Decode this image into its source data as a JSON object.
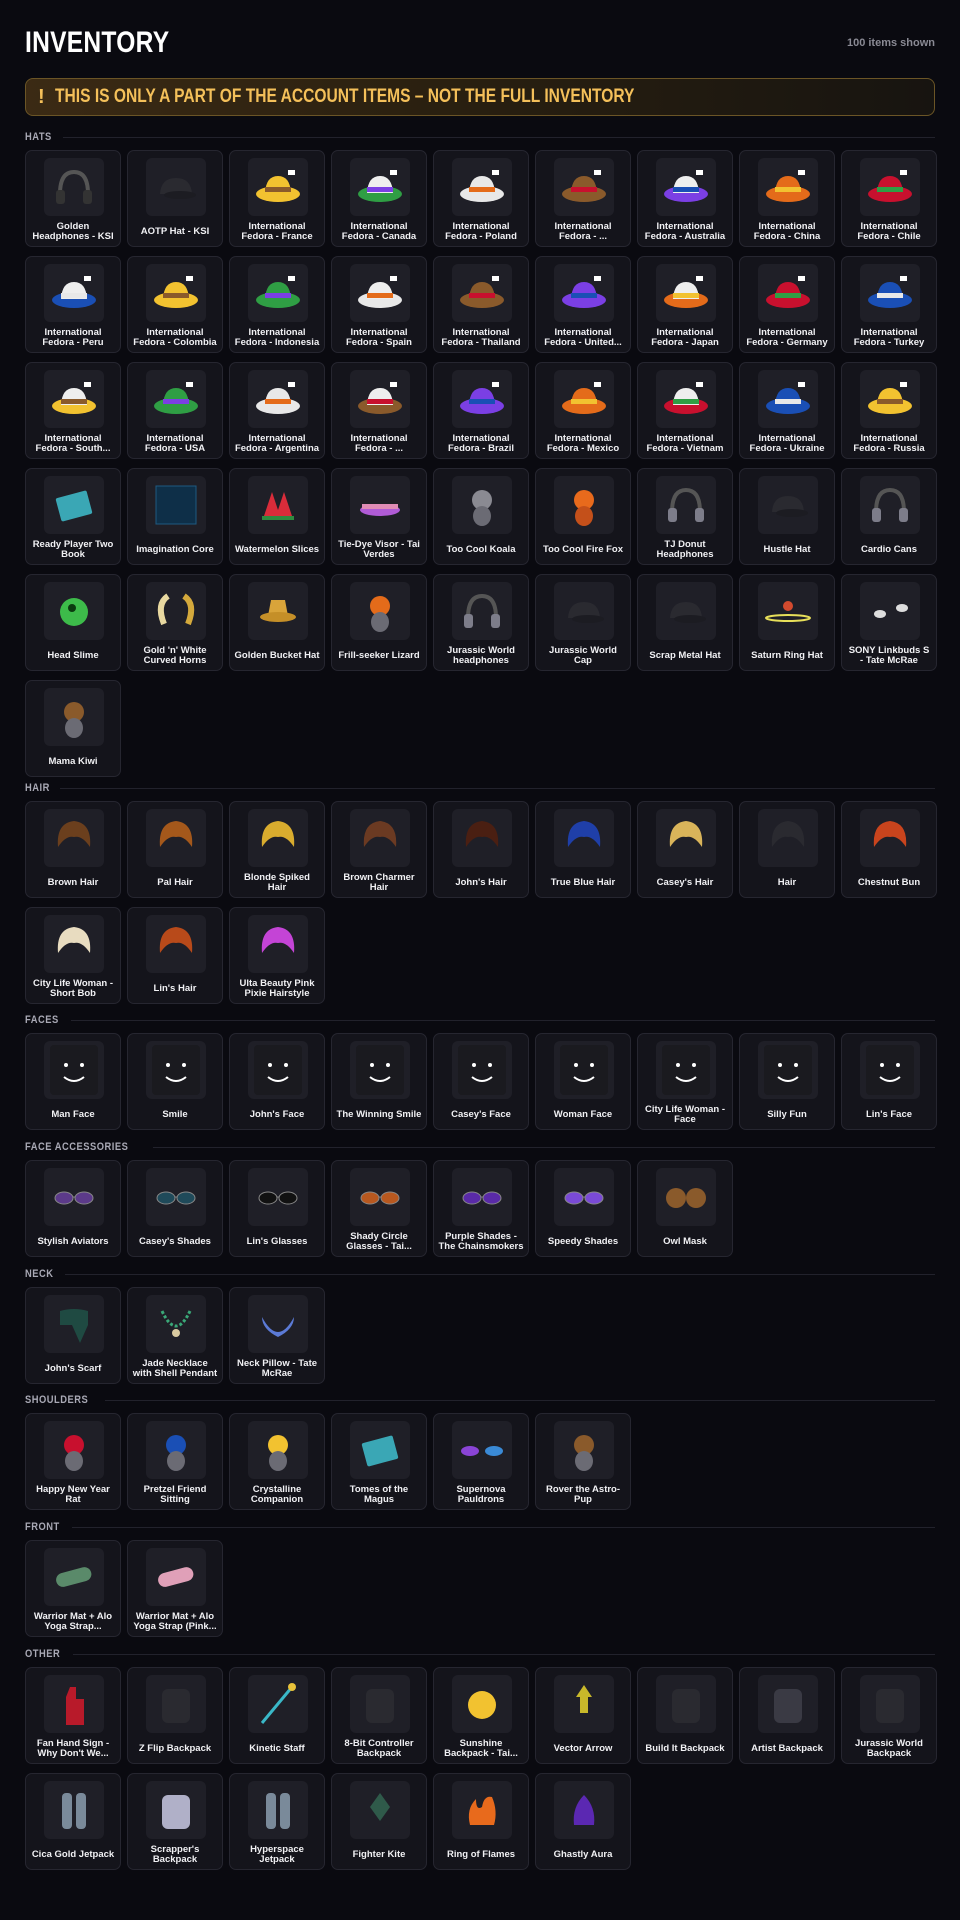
{
  "page": {
    "title": "INVENTORY",
    "items_shown": "100 items shown",
    "banner_icon": "!",
    "banner_text": "THIS IS ONLY A PART OF THE ACCOUNT ITEMS – NOT THE FULL INVENTORY"
  },
  "colors": {
    "background": "#0a0a10",
    "card": "#14141b",
    "accent": "#f4c05a"
  },
  "sections": [
    {
      "label": "HATS",
      "items": [
        {
          "name": "Golden Headphones - KSI",
          "icon": "headphones"
        },
        {
          "name": "AOTP Hat - KSI",
          "icon": "hat"
        },
        {
          "name": "International Fedora - France",
          "icon": "fedora"
        },
        {
          "name": "International Fedora - Canada",
          "icon": "fedora"
        },
        {
          "name": "International Fedora - Poland",
          "icon": "fedora"
        },
        {
          "name": "International Fedora - ...",
          "icon": "fedora"
        },
        {
          "name": "International Fedora - Australia",
          "icon": "fedora"
        },
        {
          "name": "International Fedora - China",
          "icon": "fedora"
        },
        {
          "name": "International Fedora - Chile",
          "icon": "fedora"
        },
        {
          "name": "International Fedora - Peru",
          "icon": "fedora"
        },
        {
          "name": "International Fedora - Colombia",
          "icon": "fedora"
        },
        {
          "name": "International Fedora - Indonesia",
          "icon": "fedora"
        },
        {
          "name": "International Fedora - Spain",
          "icon": "fedora"
        },
        {
          "name": "International Fedora - Thailand",
          "icon": "fedora"
        },
        {
          "name": "International Fedora - United...",
          "icon": "fedora"
        },
        {
          "name": "International Fedora - Japan",
          "icon": "fedora"
        },
        {
          "name": "International Fedora - Germany",
          "icon": "fedora"
        },
        {
          "name": "International Fedora - Turkey",
          "icon": "fedora"
        },
        {
          "name": "International Fedora - South...",
          "icon": "fedora"
        },
        {
          "name": "International Fedora - USA",
          "icon": "fedora"
        },
        {
          "name": "International Fedora - Argentina",
          "icon": "fedora"
        },
        {
          "name": "International Fedora - ...",
          "icon": "fedora"
        },
        {
          "name": "International Fedora - Brazil",
          "icon": "fedora"
        },
        {
          "name": "International Fedora - Mexico",
          "icon": "fedora"
        },
        {
          "name": "International Fedora - Vietnam",
          "icon": "fedora"
        },
        {
          "name": "International Fedora - Ukraine",
          "icon": "fedora"
        },
        {
          "name": "International Fedora - Russia",
          "icon": "fedora"
        },
        {
          "name": "Ready Player Two Book",
          "icon": "book"
        },
        {
          "name": "Imagination Core",
          "icon": "cube"
        },
        {
          "name": "Watermelon Slices",
          "icon": "watermelon"
        },
        {
          "name": "Tie-Dye Visor - Tai Verdes",
          "icon": "visor"
        },
        {
          "name": "Too Cool Koala",
          "icon": "koala"
        },
        {
          "name": "Too Cool Fire Fox",
          "icon": "fox"
        },
        {
          "name": "TJ Donut Headphones",
          "icon": "headphones"
        },
        {
          "name": "Hustle Hat",
          "icon": "cap"
        },
        {
          "name": "Cardio Cans",
          "icon": "headphones"
        },
        {
          "name": "Head Slime",
          "icon": "slime"
        },
        {
          "name": "Gold 'n' White Curved Horns",
          "icon": "horns"
        },
        {
          "name": "Golden Bucket Hat",
          "icon": "bucket-hat"
        },
        {
          "name": "Frill-seeker Lizard",
          "icon": "lizard"
        },
        {
          "name": "Jurassic World headphones",
          "icon": "headphones"
        },
        {
          "name": "Jurassic World Cap",
          "icon": "cap"
        },
        {
          "name": "Scrap Metal Hat",
          "icon": "cap"
        },
        {
          "name": "Saturn Ring Hat",
          "icon": "ring"
        },
        {
          "name": "SONY Linkbuds S - Tate McRae",
          "icon": "earbuds"
        },
        {
          "name": "Mama Kiwi",
          "icon": "bird"
        }
      ]
    },
    {
      "label": "HAIR",
      "items": [
        {
          "name": "Brown Hair",
          "icon": "hair"
        },
        {
          "name": "Pal Hair",
          "icon": "hair"
        },
        {
          "name": "Blonde Spiked Hair",
          "icon": "hair"
        },
        {
          "name": "Brown Charmer Hair",
          "icon": "hair"
        },
        {
          "name": "John's Hair",
          "icon": "hair"
        },
        {
          "name": "True Blue Hair",
          "icon": "hair"
        },
        {
          "name": "Casey's Hair",
          "icon": "hair"
        },
        {
          "name": "Hair",
          "icon": "hair"
        },
        {
          "name": "Chestnut Bun",
          "icon": "hair"
        },
        {
          "name": "City Life Woman - Short Bob",
          "icon": "hair"
        },
        {
          "name": "Lin's Hair",
          "icon": "hair"
        },
        {
          "name": "Ulta Beauty Pink Pixie Hairstyle",
          "icon": "hair"
        }
      ]
    },
    {
      "label": "FACES",
      "items": [
        {
          "name": "Man Face",
          "icon": "face"
        },
        {
          "name": "Smile",
          "icon": "face"
        },
        {
          "name": "John's Face",
          "icon": "face"
        },
        {
          "name": "The Winning Smile",
          "icon": "face"
        },
        {
          "name": "Casey's Face",
          "icon": "face"
        },
        {
          "name": "Woman Face",
          "icon": "face"
        },
        {
          "name": "City Life Woman - Face",
          "icon": "face"
        },
        {
          "name": "Silly Fun",
          "icon": "face"
        },
        {
          "name": "Lin's Face",
          "icon": "face"
        }
      ]
    },
    {
      "label": "FACE ACCESSORIES",
      "items": [
        {
          "name": "Stylish Aviators",
          "icon": "glasses"
        },
        {
          "name": "Casey's Shades",
          "icon": "glasses"
        },
        {
          "name": "Lin's Glasses",
          "icon": "glasses"
        },
        {
          "name": "Shady Circle Glasses - Tai...",
          "icon": "glasses"
        },
        {
          "name": "Purple Shades - The Chainsmokers",
          "icon": "glasses"
        },
        {
          "name": "Speedy Shades",
          "icon": "glasses"
        },
        {
          "name": "Owl Mask",
          "icon": "mask"
        }
      ]
    },
    {
      "label": "NECK",
      "items": [
        {
          "name": "John's Scarf",
          "icon": "scarf"
        },
        {
          "name": "Jade Necklace with Shell Pendant",
          "icon": "necklace"
        },
        {
          "name": "Neck Pillow - Tate McRae",
          "icon": "pillow"
        }
      ]
    },
    {
      "label": "SHOULDERS",
      "items": [
        {
          "name": "Happy New Year Rat",
          "icon": "pet"
        },
        {
          "name": "Pretzel Friend Sitting",
          "icon": "pet"
        },
        {
          "name": "Crystalline Companion",
          "icon": "pet"
        },
        {
          "name": "Tomes of the Magus",
          "icon": "book"
        },
        {
          "name": "Supernova Pauldrons",
          "icon": "pauldrons"
        },
        {
          "name": "Rover the Astro-Pup",
          "icon": "pet"
        }
      ]
    },
    {
      "label": "FRONT",
      "items": [
        {
          "name": "Warrior Mat + Alo Yoga Strap...",
          "icon": "mat"
        },
        {
          "name": "Warrior Mat + Alo Yoga Strap (Pink...",
          "icon": "mat"
        }
      ]
    },
    {
      "label": "OTHER",
      "items": [
        {
          "name": "Fan Hand Sign - Why Don't We...",
          "icon": "foam-hand"
        },
        {
          "name": "Z Flip Backpack",
          "icon": "backpack"
        },
        {
          "name": "Kinetic Staff",
          "icon": "staff"
        },
        {
          "name": "8-Bit Controller Backpack",
          "icon": "backpack"
        },
        {
          "name": "Sunshine Backpack - Tai...",
          "icon": "sun"
        },
        {
          "name": "Vector Arrow",
          "icon": "arrow"
        },
        {
          "name": "Build It Backpack",
          "icon": "backpack"
        },
        {
          "name": "Artist Backpack",
          "icon": "backpack"
        },
        {
          "name": "Jurassic World Backpack",
          "icon": "backpack"
        },
        {
          "name": "Cica Gold Jetpack",
          "icon": "jetpack"
        },
        {
          "name": "Scrapper's Backpack",
          "icon": "backpack"
        },
        {
          "name": "Hyperspace Jetpack",
          "icon": "jetpack"
        },
        {
          "name": "Fighter Kite",
          "icon": "kite"
        },
        {
          "name": "Ring of Flames",
          "icon": "flames"
        },
        {
          "name": "Ghastly Aura",
          "icon": "aura"
        }
      ]
    }
  ]
}
